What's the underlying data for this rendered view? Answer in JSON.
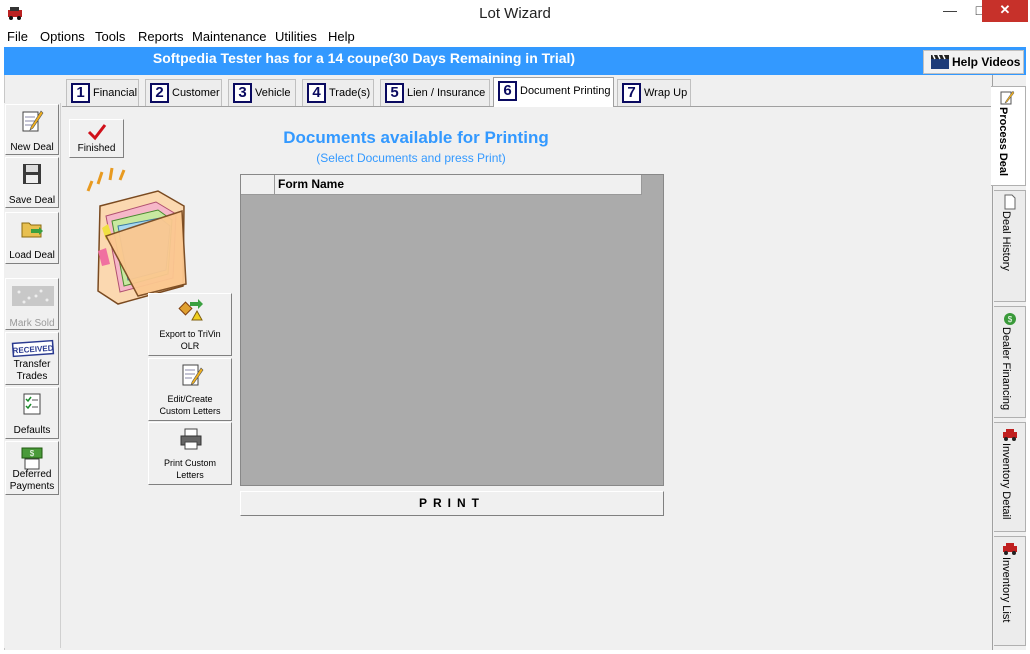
{
  "window": {
    "title": "Lot Wizard",
    "minimize": "—",
    "maximize": "□",
    "close": "✕"
  },
  "menu": [
    "File",
    "Options",
    "Tools",
    "Reports",
    "Maintenance",
    "Utilities",
    "Help"
  ],
  "banner": {
    "text": "Softpedia Tester has  for a 14  coupe(30 Days Remaining in Trial)",
    "help_videos": "Help Videos"
  },
  "sidebar": [
    {
      "label": "New Deal",
      "icon": "notepad-pencil-icon"
    },
    {
      "label": "Save Deal",
      "icon": "floppy-disk-icon"
    },
    {
      "label": "Load Deal",
      "icon": "folder-open-icon"
    },
    {
      "label": "Mark Sold",
      "icon": "sold-stamp-icon",
      "disabled": true
    },
    {
      "label": "Transfer Trades",
      "icon": "received-stamp-icon"
    },
    {
      "label": "Defaults",
      "icon": "checklist-icon"
    },
    {
      "label": "Deferred Payments",
      "icon": "money-icon"
    }
  ],
  "tabs": [
    {
      "num": "1",
      "label": "Financial"
    },
    {
      "num": "2",
      "label": "Customer"
    },
    {
      "num": "3",
      "label": "Vehicle"
    },
    {
      "num": "4",
      "label": "Trade(s)"
    },
    {
      "num": "5",
      "label": "Lien / Insurance"
    },
    {
      "num": "6",
      "label": "Document Printing",
      "active": true
    },
    {
      "num": "7",
      "label": "Wrap Up"
    }
  ],
  "finished_label": "Finished",
  "actions": [
    {
      "label": "Export to TriVin OLR",
      "icon": "export-icon"
    },
    {
      "label": "Edit/Create Custom Letters",
      "icon": "edit-document-icon"
    },
    {
      "label": "Print Custom Letters",
      "icon": "printer-icon"
    }
  ],
  "documents": {
    "title": "Documents available for Printing",
    "subtitle": "(Select Documents and press Print)",
    "column": "Form Name",
    "print_label": "PRINT"
  },
  "right_tabs": [
    {
      "label": "Process Deal",
      "icon": "pencil-note-icon",
      "active": true
    },
    {
      "label": "Deal History",
      "icon": "document-icon"
    },
    {
      "label": "Dealer Financing",
      "icon": "money-bag-icon"
    },
    {
      "label": "Inventory Detail",
      "icon": "car-icon"
    },
    {
      "label": "Inventory List",
      "icon": "car-icon"
    }
  ],
  "colors": {
    "banner": "#3399ff",
    "accent_text": "#3399ff",
    "close": "#c7312a"
  }
}
